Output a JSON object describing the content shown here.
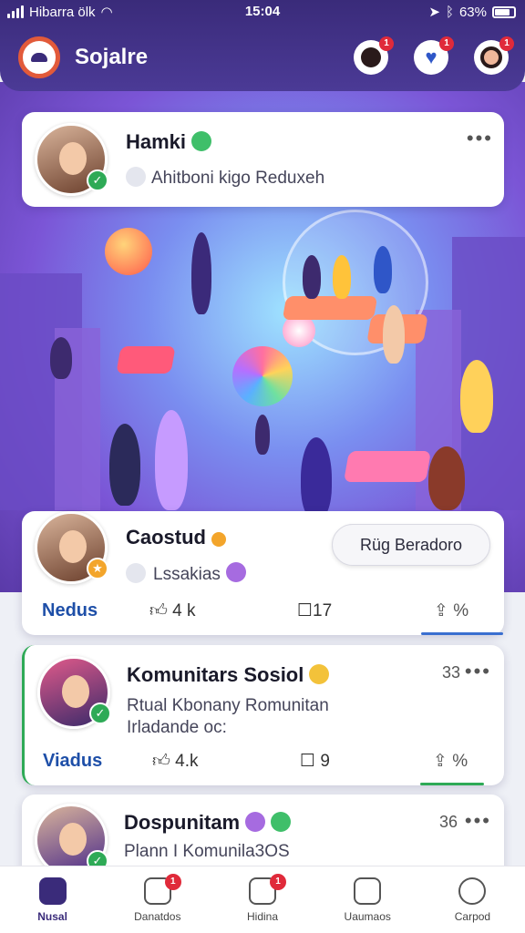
{
  "status": {
    "carrier": "Hibarra ölk",
    "time": "15:04",
    "battery": "63%"
  },
  "app": {
    "title": "Sojalre"
  },
  "header_icons": [
    {
      "icon": "user-avatar-icon",
      "badge": "1"
    },
    {
      "icon": "heart-shield-icon",
      "badge": "1"
    },
    {
      "icon": "profile-avatar-icon",
      "badge": "1"
    }
  ],
  "profile_card": {
    "name": "Hamki",
    "subtitle": "Ahitboni kigo Reduxeh",
    "more": "•••",
    "badge_color": "#2eaa56"
  },
  "posts": [
    {
      "name": "Caostud",
      "subtitle": "Lssakias",
      "action_button": "Rüg Beradoro",
      "link": "Nedus",
      "likes": "4 k",
      "comments": "17",
      "share": "%",
      "badge_color": "#f3a52b"
    },
    {
      "name": "Komunitars Sosiol",
      "subtitle_line1": "Rtual Kbonany Romunitan",
      "subtitle_line2": "Irladande oc:",
      "count": "33",
      "more": "•••",
      "link": "Viadus",
      "likes": "4.k",
      "comments": "9",
      "share": "%",
      "badge_color": "#2eaa56"
    },
    {
      "name": "Dospunitam",
      "subtitle": "Plann I Komunila3OS",
      "count": "36",
      "more": "•••",
      "badge_color": "#2eaa56"
    }
  ],
  "nav": [
    {
      "label": "Nusal",
      "icon": "home-icon",
      "active": true
    },
    {
      "label": "Danatdos",
      "icon": "house-outline-icon",
      "badge": "1"
    },
    {
      "label": "Hidina",
      "icon": "chat-face-icon",
      "badge": "1"
    },
    {
      "label": "Uaumaos",
      "icon": "smile-box-icon"
    },
    {
      "label": "Carpod",
      "icon": "person-icon"
    }
  ],
  "colors": {
    "accent": "#3a2b7a",
    "link": "#1e4fa8",
    "badge": "#e02a3a"
  }
}
